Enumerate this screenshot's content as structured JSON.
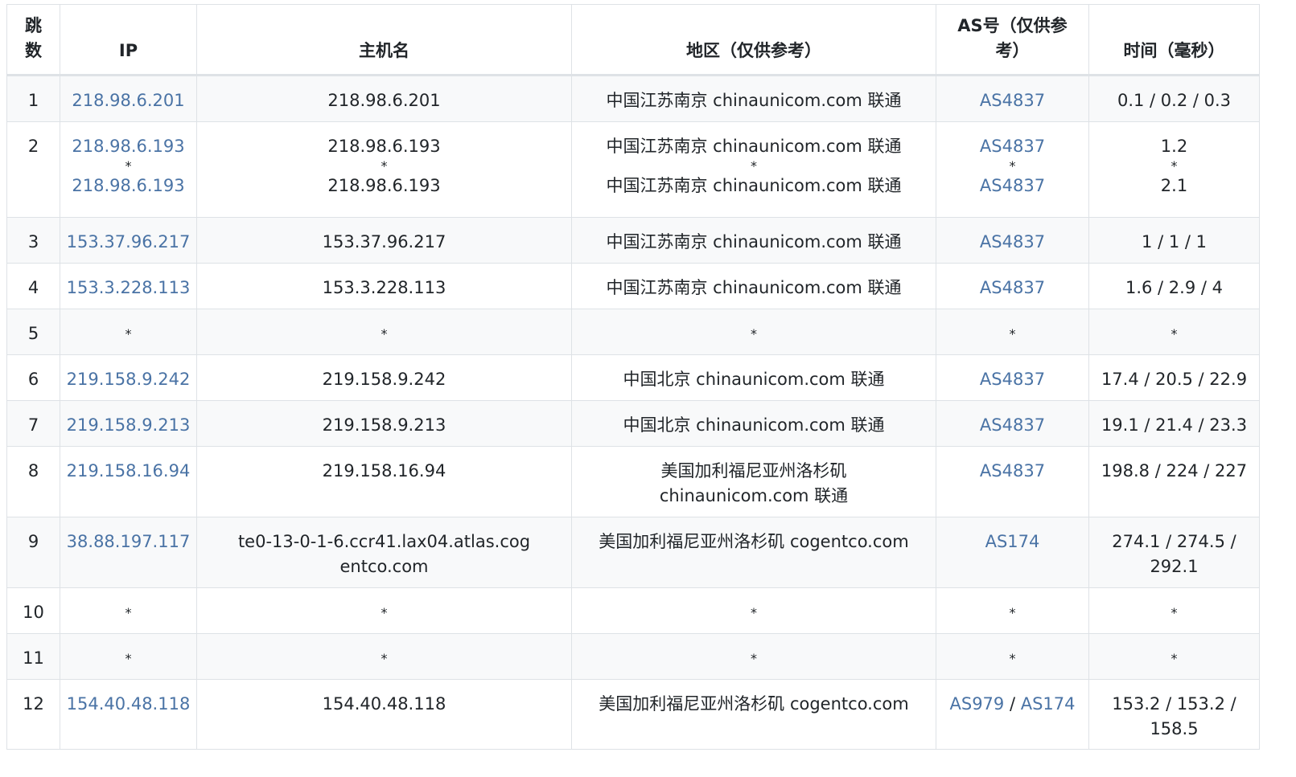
{
  "headers": [
    "跳数",
    "IP",
    "主机名",
    "地区（仅供参考）",
    "AS号（仅供参考）",
    "时间（毫秒）"
  ],
  "rows": [
    {
      "hop": "1",
      "ip": [
        "218.98.6.201"
      ],
      "host": [
        "218.98.6.201"
      ],
      "region": [
        "中国江苏南京 chinaunicom.com 联通"
      ],
      "as": [
        "AS4837"
      ],
      "time": "0.1 / 0.2 / 0.3"
    },
    {
      "hop": "2",
      "ip": [
        "218.98.6.193",
        "*",
        "218.98.6.193"
      ],
      "host": [
        "218.98.6.193",
        "*",
        "218.98.6.193"
      ],
      "region": [
        "中国江苏南京 chinaunicom.com 联通",
        "*",
        "中国江苏南京 chinaunicom.com 联通"
      ],
      "as": [
        "AS4837",
        "*",
        "AS4837"
      ],
      "time_lines": [
        "1.2",
        "*",
        "2.1"
      ]
    },
    {
      "hop": "3",
      "ip": [
        "153.37.96.217"
      ],
      "host": [
        "153.37.96.217"
      ],
      "region": [
        "中国江苏南京 chinaunicom.com 联通"
      ],
      "as": [
        "AS4837"
      ],
      "time": "1 / 1 / 1"
    },
    {
      "hop": "4",
      "ip": [
        "153.3.228.113"
      ],
      "host": [
        "153.3.228.113"
      ],
      "region": [
        "中国江苏南京 chinaunicom.com 联通"
      ],
      "as": [
        "AS4837"
      ],
      "time": "1.6 / 2.9 / 4"
    },
    {
      "hop": "5",
      "ip": [
        "*"
      ],
      "host": [
        "*"
      ],
      "region": [
        "*"
      ],
      "as": [
        "*"
      ],
      "time": "*"
    },
    {
      "hop": "6",
      "ip": [
        "219.158.9.242"
      ],
      "host": [
        "219.158.9.242"
      ],
      "region": [
        "中国北京 chinaunicom.com 联通"
      ],
      "as": [
        "AS4837"
      ],
      "time": "17.4 / 20.5 / 22.9"
    },
    {
      "hop": "7",
      "ip": [
        "219.158.9.213"
      ],
      "host": [
        "219.158.9.213"
      ],
      "region": [
        "中国北京 chinaunicom.com 联通"
      ],
      "as": [
        "AS4837"
      ],
      "time": "19.1 / 21.4 / 23.3"
    },
    {
      "hop": "8",
      "ip": [
        "219.158.16.94"
      ],
      "host": [
        "219.158.16.94"
      ],
      "region": [
        "美国加利福尼亚州洛杉矶 chinaunicom.com 联通"
      ],
      "as": [
        "AS4837"
      ],
      "time": "198.8 / 224 / 227"
    },
    {
      "hop": "9",
      "ip": [
        "38.88.197.117"
      ],
      "host": [
        "te0-13-0-1-6.ccr41.lax04.atlas.cogentco.com"
      ],
      "region": [
        "美国加利福尼亚州洛杉矶 cogentco.com"
      ],
      "as": [
        "AS174"
      ],
      "time": "274.1 / 274.5 / 292.1"
    },
    {
      "hop": "10",
      "ip": [
        "*"
      ],
      "host": [
        "*"
      ],
      "region": [
        "*"
      ],
      "as": [
        "*"
      ],
      "time": "*"
    },
    {
      "hop": "11",
      "ip": [
        "*"
      ],
      "host": [
        "*"
      ],
      "region": [
        "*"
      ],
      "as": [
        "*"
      ],
      "time": "*"
    },
    {
      "hop": "12",
      "ip": [
        "154.40.48.118"
      ],
      "host": [
        "154.40.48.118"
      ],
      "region": [
        "美国加利福尼亚州洛杉矶 cogentco.com"
      ],
      "as": [
        "AS979",
        "AS174"
      ],
      "as_separator": " / ",
      "time": "153.2 / 153.2 / 158.5"
    }
  ],
  "colors": {
    "link": "#4a73a5",
    "stripe": "#f8f9fa",
    "border": "#dee2e6"
  }
}
